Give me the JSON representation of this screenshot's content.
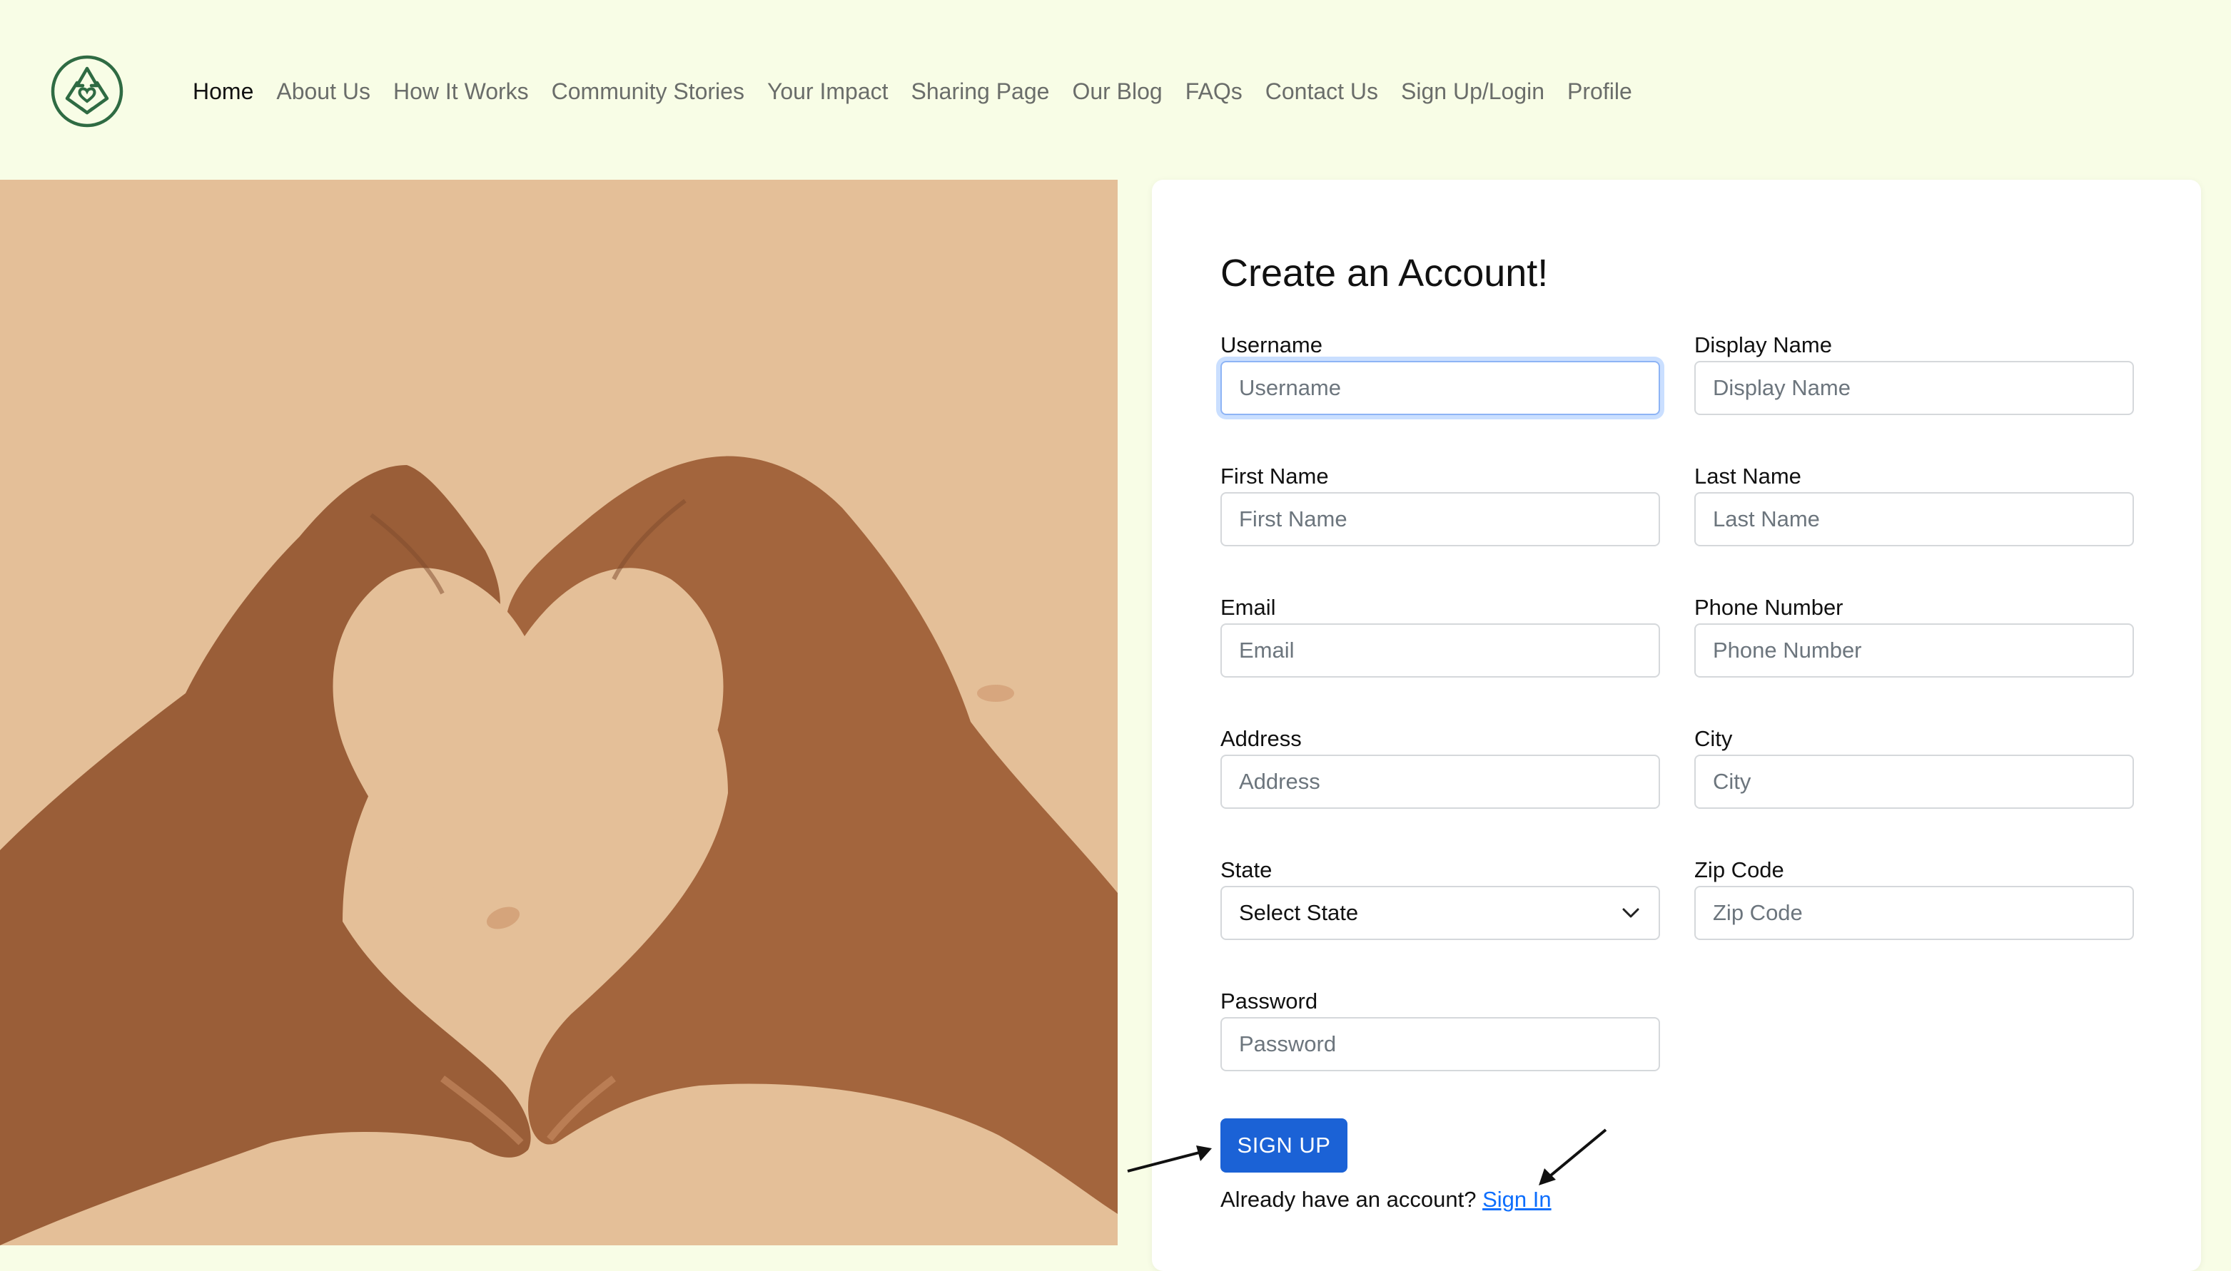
{
  "nav": {
    "logo_icon": "recycle-heart-logo-icon",
    "items": [
      {
        "label": "Home",
        "active": true
      },
      {
        "label": "About Us"
      },
      {
        "label": "How It Works"
      },
      {
        "label": "Community Stories"
      },
      {
        "label": "Your Impact"
      },
      {
        "label": "Sharing Page"
      },
      {
        "label": "Our Blog"
      },
      {
        "label": "FAQs"
      },
      {
        "label": "Contact Us"
      },
      {
        "label": "Sign Up/Login"
      },
      {
        "label": "Profile"
      }
    ]
  },
  "hero": {
    "image_subject": "two hands forming a heart shape on a tan background",
    "background_color": "#e4bf98"
  },
  "form": {
    "title": "Create an Account!",
    "fields": {
      "username": {
        "label": "Username",
        "placeholder": "Username",
        "value": ""
      },
      "display_name": {
        "label": "Display Name",
        "placeholder": "Display Name",
        "value": ""
      },
      "first_name": {
        "label": "First Name",
        "placeholder": "First Name",
        "value": ""
      },
      "last_name": {
        "label": "Last Name",
        "placeholder": "Last Name",
        "value": ""
      },
      "email": {
        "label": "Email",
        "placeholder": "Email",
        "value": ""
      },
      "phone": {
        "label": "Phone Number",
        "placeholder": "Phone Number",
        "value": ""
      },
      "address": {
        "label": "Address",
        "placeholder": "Address",
        "value": ""
      },
      "city": {
        "label": "City",
        "placeholder": "City",
        "value": ""
      },
      "state": {
        "label": "State",
        "selected": "Select State"
      },
      "zip": {
        "label": "Zip Code",
        "placeholder": "Zip Code",
        "value": ""
      },
      "password": {
        "label": "Password",
        "placeholder": "Password",
        "value": ""
      }
    },
    "submit_label": "SIGN UP",
    "signin_prompt": "Already have an account?",
    "signin_link": "Sign In"
  },
  "colors": {
    "page_bg": "#f8fde6",
    "primary": "#1b62d6",
    "link": "#0d6efd",
    "logo_green": "#2f6b43"
  }
}
